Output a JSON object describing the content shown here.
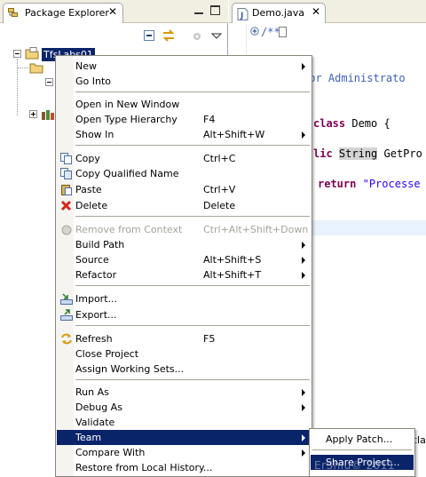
{
  "package_explorer": {
    "tab_label": "Package Explorer",
    "close_glyph": "✕",
    "project_label": "TfsLabs01",
    "icons": [
      "collapse-all-icon",
      "link-with-editor-icon",
      "filter-icon",
      "view-menu-icon"
    ]
  },
  "editor": {
    "tab_label": "Demo.java",
    "close_glyph": "✕",
    "code": {
      "comment_open": "/**",
      "author_fragment": "hor Administrato",
      "class_kw": "class",
      "class_name": " Demo {",
      "method_kw": "lic",
      "method_type": "String",
      "method_name": " GetPro",
      "return_kw": "return",
      "return_str": "\"Processe"
    }
  },
  "context_menu": {
    "items": [
      {
        "label": "New",
        "accel": "",
        "submenu": true
      },
      {
        "label": "Go Into",
        "accel": "",
        "submenu": false
      },
      {
        "label": "Open in New Window",
        "accel": "",
        "submenu": false
      },
      {
        "label": "Open Type Hierarchy",
        "accel": "F4",
        "submenu": false
      },
      {
        "label": "Show In",
        "accel": "Alt+Shift+W",
        "submenu": true
      },
      {
        "label": "Copy",
        "accel": "Ctrl+C",
        "submenu": false
      },
      {
        "label": "Copy Qualified Name",
        "accel": "",
        "submenu": false
      },
      {
        "label": "Paste",
        "accel": "Ctrl+V",
        "submenu": false
      },
      {
        "label": "Delete",
        "accel": "Delete",
        "submenu": false
      },
      {
        "label": "Remove from Context",
        "accel": "Ctrl+Alt+Shift+Down",
        "submenu": false,
        "disabled": true
      },
      {
        "label": "Build Path",
        "accel": "",
        "submenu": true
      },
      {
        "label": "Source",
        "accel": "Alt+Shift+S",
        "submenu": true
      },
      {
        "label": "Refactor",
        "accel": "Alt+Shift+T",
        "submenu": true
      },
      {
        "label": "Import...",
        "accel": "",
        "submenu": false
      },
      {
        "label": "Export...",
        "accel": "",
        "submenu": false
      },
      {
        "label": "Refresh",
        "accel": "F5",
        "submenu": false
      },
      {
        "label": "Close Project",
        "accel": "",
        "submenu": false
      },
      {
        "label": "Assign Working Sets...",
        "accel": "",
        "submenu": false
      },
      {
        "label": "Run As",
        "accel": "",
        "submenu": true
      },
      {
        "label": "Debug As",
        "accel": "",
        "submenu": true
      },
      {
        "label": "Validate",
        "accel": "",
        "submenu": false
      },
      {
        "label": "Team",
        "accel": "",
        "submenu": true,
        "selected": true
      },
      {
        "label": "Compare With",
        "accel": "",
        "submenu": true
      },
      {
        "label": "Restore from Local History...",
        "accel": "",
        "submenu": false
      }
    ]
  },
  "team_submenu": {
    "items": [
      {
        "label": "Apply Patch..."
      },
      {
        "label": "Share Project...",
        "selected": true
      }
    ]
  },
  "background_fragment": "cla",
  "watermark": "ErShiu© 2011",
  "colors": {
    "selection": "#0a246a",
    "keyword": "#7f0055",
    "string": "#2a00ff",
    "comment": "#3f5fbf",
    "tab_bar": "#f1efe2"
  }
}
